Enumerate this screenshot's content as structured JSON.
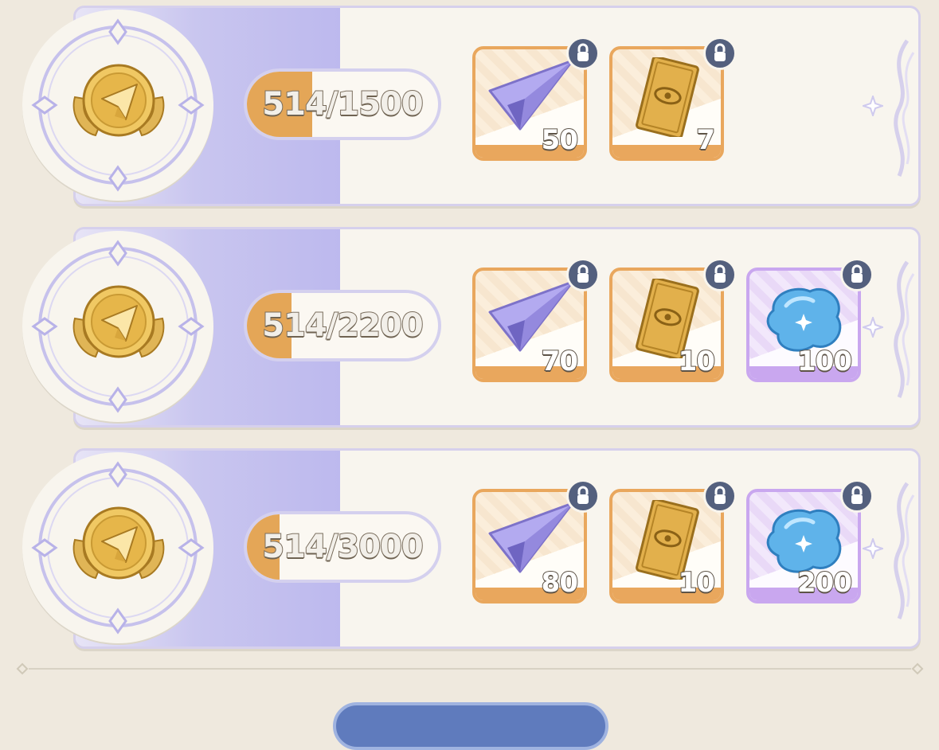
{
  "tiers": [
    {
      "progress_text": "514/1500",
      "progress_fraction": 0.343,
      "rewards": [
        {
          "icon": "paper-plane-icon",
          "quantity": "50",
          "frame": "orange",
          "locked": true
        },
        {
          "icon": "eye-card-icon",
          "quantity": "7",
          "frame": "orange",
          "locked": true
        }
      ]
    },
    {
      "progress_text": "514/2200",
      "progress_fraction": 0.234,
      "rewards": [
        {
          "icon": "paper-plane-icon",
          "quantity": "70",
          "frame": "orange",
          "locked": true
        },
        {
          "icon": "eye-card-icon",
          "quantity": "10",
          "frame": "orange",
          "locked": true
        },
        {
          "icon": "blue-crystal-icon",
          "quantity": "100",
          "frame": "purple",
          "locked": true
        }
      ]
    },
    {
      "progress_text": "514/3000",
      "progress_fraction": 0.171,
      "rewards": [
        {
          "icon": "paper-plane-icon",
          "quantity": "80",
          "frame": "orange",
          "locked": true
        },
        {
          "icon": "eye-card-icon",
          "quantity": "10",
          "frame": "orange",
          "locked": true
        },
        {
          "icon": "blue-crystal-icon",
          "quantity": "200",
          "frame": "purple",
          "locked": true
        }
      ]
    }
  ],
  "colors": {
    "progress_fill": "#e4a657",
    "panel_accent": "#bdb9ee",
    "lock_badge": "#54607e",
    "orange_frame": "#e9a75d",
    "purple_frame": "#c9a7ef"
  }
}
